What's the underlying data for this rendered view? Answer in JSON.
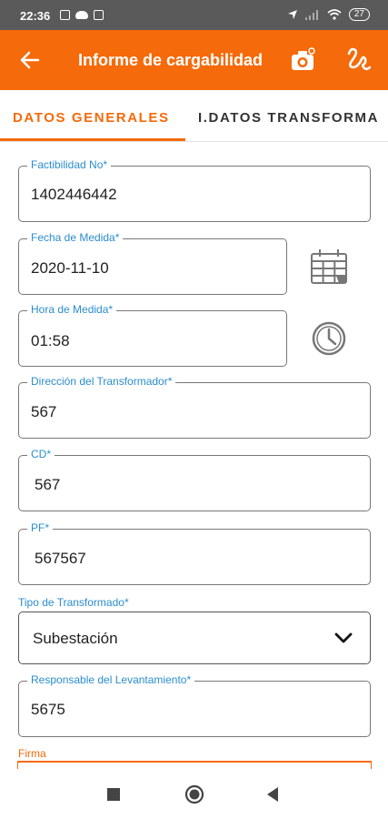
{
  "status_bar": {
    "time": "22:36",
    "battery": "27"
  },
  "app_bar": {
    "title": "Informe de cargabilidad"
  },
  "tabs": [
    {
      "label": "DATOS GENERALES"
    },
    {
      "label": "I.DATOS TRANSFORMA"
    }
  ],
  "form": {
    "factibilidad": {
      "label": "Factibilidad No*",
      "value": "1402446442"
    },
    "fecha": {
      "label": "Fecha de Medida*",
      "value": "2020-11-10"
    },
    "hora": {
      "label": "Hora de Medida*",
      "value": "01:58"
    },
    "direccion": {
      "label": "Dirección del Transformador*",
      "value": "567"
    },
    "cd": {
      "label": "CD*",
      "value": "567"
    },
    "pf": {
      "label": "PF*",
      "value": "567567"
    },
    "tipo": {
      "label": "Tipo de Transformado*",
      "value": "Subestación"
    },
    "responsable": {
      "label": "Responsable del Levantamiento*",
      "value": "5675"
    },
    "firma": {
      "label": "Firma"
    }
  },
  "colors": {
    "accent": "#f56a0a",
    "label": "#2b8dcf",
    "status_bar": "#5a5a5a"
  },
  "icons": [
    "back-arrow-icon",
    "camera-icon",
    "signature-icon",
    "calendar-icon",
    "clock-icon",
    "chevron-down-icon"
  ]
}
